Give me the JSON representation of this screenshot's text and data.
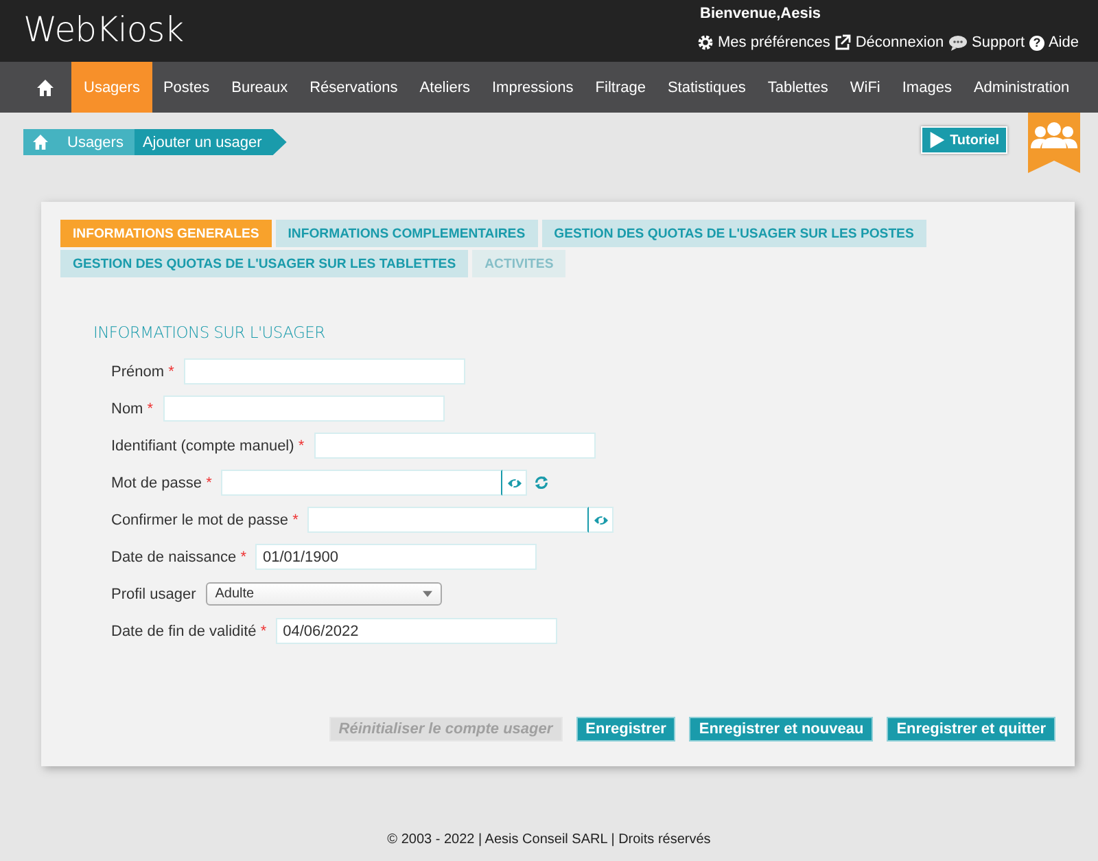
{
  "header": {
    "logo": "WebKiosk",
    "welcome": "Bienvenue,Aesis",
    "links": [
      {
        "kind": "gear",
        "label": "Mes préférences"
      },
      {
        "kind": "external",
        "label": "Déconnexion"
      },
      {
        "kind": "chat",
        "label": "Support"
      },
      {
        "kind": "help",
        "icon": "?",
        "label": "Aide"
      }
    ]
  },
  "nav": [
    {
      "label": "Usagers",
      "selected": true
    },
    {
      "label": "Postes",
      "selected": false
    },
    {
      "label": "Bureaux",
      "selected": false
    },
    {
      "label": "Réservations",
      "selected": false
    },
    {
      "label": "Ateliers",
      "selected": false
    },
    {
      "label": "Impressions",
      "selected": false
    },
    {
      "label": "Filtrage",
      "selected": false
    },
    {
      "label": "Statistiques",
      "selected": false
    },
    {
      "label": "Tablettes",
      "selected": false
    },
    {
      "label": "WiFi",
      "selected": false
    },
    {
      "label": "Images",
      "selected": false
    },
    {
      "label": "Administration",
      "selected": false
    }
  ],
  "breadcrumb": [
    "Usagers",
    "Ajouter un usager"
  ],
  "tutorial_button": "Tutoriel",
  "tabs": [
    {
      "label": "INFORMATIONS GENERALES",
      "selected": true,
      "disabled": false
    },
    {
      "label": "INFORMATIONS COMPLEMENTAIRES",
      "selected": false,
      "disabled": false
    },
    {
      "label": "GESTION DES QUOTAS DE L'USAGER SUR LES POSTES",
      "selected": false,
      "disabled": false
    },
    {
      "label": "GESTION DES QUOTAS DE L'USAGER SUR LES TABLETTES",
      "selected": false,
      "disabled": false
    },
    {
      "label": "ACTIVITES",
      "selected": false,
      "disabled": true
    }
  ],
  "section_title": "INFORMATIONS SUR L'USAGER",
  "required_marker": "*",
  "fields": [
    {
      "kind": "text",
      "label": "Prénom",
      "required": true
    },
    {
      "kind": "text",
      "label": "Nom",
      "required": true
    },
    {
      "kind": "text",
      "label": "Identifiant (compte manuel)",
      "required": true
    },
    {
      "kind": "password",
      "label": "Mot de passe",
      "required": true,
      "refresh": true
    },
    {
      "kind": "password",
      "label": "Confirmer le mot de passe",
      "required": true,
      "refresh": false
    },
    {
      "kind": "text",
      "label": "Date de naissance",
      "required": true,
      "value": "01/01/1900"
    },
    {
      "kind": "select",
      "label": "Profil usager",
      "required": false,
      "value": "Adulte"
    },
    {
      "kind": "text",
      "label": "Date de fin de validité",
      "required": true,
      "value": "04/06/2022"
    }
  ],
  "buttons": [
    {
      "label": "Réinitialiser le compte usager",
      "disabled": true
    },
    {
      "label": "Enregistrer",
      "disabled": false
    },
    {
      "label": "Enregistrer et nouveau",
      "disabled": false
    },
    {
      "label": "Enregistrer et quitter",
      "disabled": false
    }
  ],
  "footer": "© 2003 - 2022 | Aesis Conseil SARL | Droits réservés"
}
